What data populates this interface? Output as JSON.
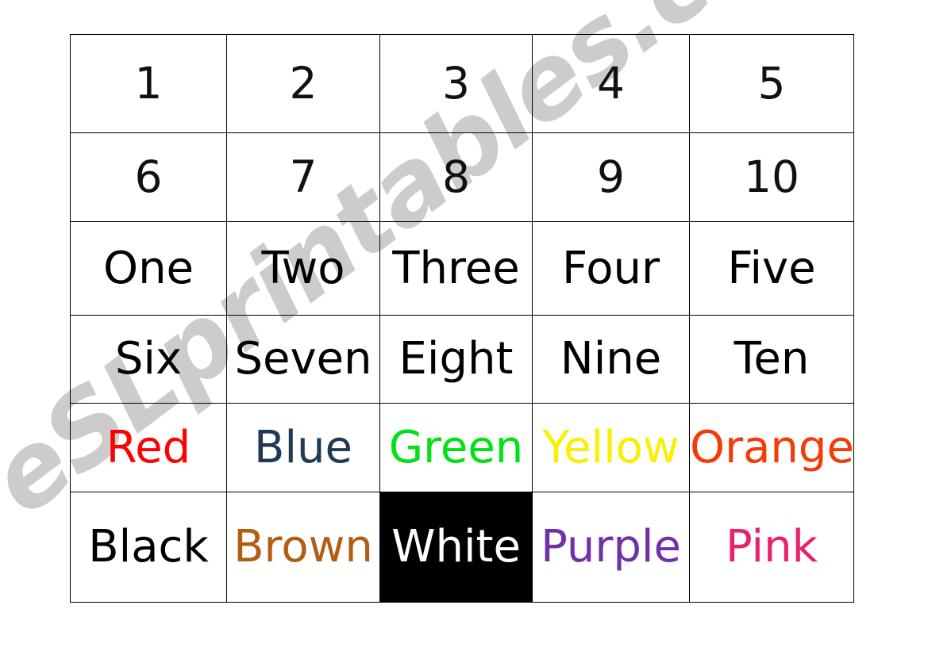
{
  "watermark": {
    "text": "eSLprintables.com",
    "color": "#cccccc"
  },
  "table": {
    "columns": 5,
    "rows": 6,
    "border_color": "#000000",
    "rows_data": [
      {
        "name": "numerals-1",
        "kind": "numeral",
        "cells": [
          {
            "text": "1",
            "color": "#111111",
            "background": "transparent"
          },
          {
            "text": "2",
            "color": "#111111",
            "background": "transparent"
          },
          {
            "text": "3",
            "color": "#111111",
            "background": "transparent"
          },
          {
            "text": "4",
            "color": "#111111",
            "background": "transparent"
          },
          {
            "text": "5",
            "color": "#111111",
            "background": "transparent"
          }
        ]
      },
      {
        "name": "numerals-2",
        "kind": "numeral",
        "cells": [
          {
            "text": "6",
            "color": "#111111",
            "background": "transparent"
          },
          {
            "text": "7",
            "color": "#111111",
            "background": "transparent"
          },
          {
            "text": "8",
            "color": "#111111",
            "background": "transparent"
          },
          {
            "text": "9",
            "color": "#111111",
            "background": "transparent"
          },
          {
            "text": "10",
            "color": "#111111",
            "background": "transparent"
          }
        ]
      },
      {
        "name": "words-1",
        "kind": "word",
        "cells": [
          {
            "text": "One",
            "color": "#000000",
            "background": "transparent"
          },
          {
            "text": "Two",
            "color": "#000000",
            "background": "transparent"
          },
          {
            "text": "Three",
            "color": "#000000",
            "background": "transparent"
          },
          {
            "text": "Four",
            "color": "#000000",
            "background": "transparent"
          },
          {
            "text": "Five",
            "color": "#000000",
            "background": "transparent"
          }
        ]
      },
      {
        "name": "words-2",
        "kind": "word",
        "cells": [
          {
            "text": "Six",
            "color": "#000000",
            "background": "transparent"
          },
          {
            "text": "Seven",
            "color": "#000000",
            "background": "transparent"
          },
          {
            "text": "Eight",
            "color": "#000000",
            "background": "transparent"
          },
          {
            "text": "Nine",
            "color": "#000000",
            "background": "transparent"
          },
          {
            "text": "Ten",
            "color": "#000000",
            "background": "transparent"
          }
        ]
      },
      {
        "name": "colors-1",
        "kind": "colorword",
        "cells": [
          {
            "text": "Red",
            "color": "#ff0000",
            "background": "transparent"
          },
          {
            "text": "Blue",
            "color": "#1f3a56",
            "background": "transparent"
          },
          {
            "text": "Green",
            "color": "#00e215",
            "background": "transparent"
          },
          {
            "text": "Yellow",
            "color": "#f8f000",
            "background": "transparent"
          },
          {
            "text": "Orange",
            "color": "#f43a08",
            "background": "transparent"
          }
        ]
      },
      {
        "name": "colors-2",
        "kind": "colorword",
        "cells": [
          {
            "text": "Black",
            "color": "#000000",
            "background": "transparent"
          },
          {
            "text": "Brown",
            "color": "#b25c14",
            "background": "transparent"
          },
          {
            "text": "White",
            "color": "#ffffff",
            "background": "#000000"
          },
          {
            "text": "Purple",
            "color": "#7030a8",
            "background": "transparent"
          },
          {
            "text": "Pink",
            "color": "#e8216a",
            "background": "transparent"
          }
        ]
      }
    ]
  }
}
